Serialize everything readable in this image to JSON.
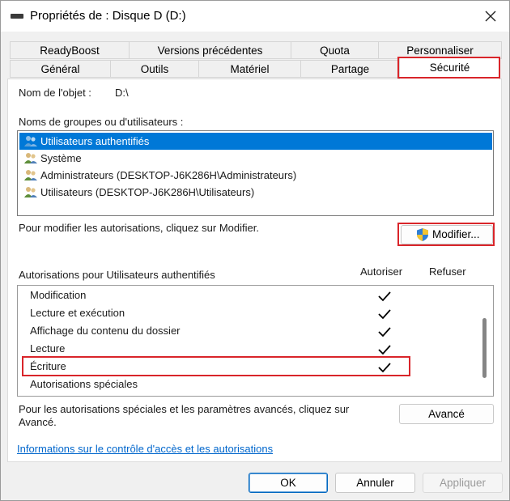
{
  "window": {
    "title": "Propriétés de : Disque D (D:)"
  },
  "tabs_row1": [
    "ReadyBoost",
    "Versions précédentes",
    "Quota",
    "Personnaliser"
  ],
  "tabs_row2": [
    "Général",
    "Outils",
    "Matériel",
    "Partage",
    "Sécurité"
  ],
  "object": {
    "label": "Nom de l'objet :",
    "value": "D:\\"
  },
  "groups": {
    "label": "Noms de groupes ou d'utilisateurs :",
    "items": [
      "Utilisateurs authentifiés",
      "Système",
      "Administrateurs (DESKTOP-J6K286H\\Administrateurs)",
      "Utilisateurs (DESKTOP-J6K286H\\Utilisateurs)"
    ]
  },
  "modify": {
    "hint": "Pour modifier les autorisations, cliquez sur Modifier.",
    "button": "Modifier..."
  },
  "permissions": {
    "title": "Autorisations pour Utilisateurs authentifiés",
    "allow_header": "Autoriser",
    "deny_header": "Refuser",
    "rows": [
      {
        "name": "Modification",
        "allow": true,
        "deny": false
      },
      {
        "name": "Lecture et exécution",
        "allow": true,
        "deny": false
      },
      {
        "name": "Affichage du contenu du dossier",
        "allow": true,
        "deny": false
      },
      {
        "name": "Lecture",
        "allow": true,
        "deny": false
      },
      {
        "name": "Écriture",
        "allow": true,
        "deny": false
      },
      {
        "name": "Autorisations spéciales",
        "allow": false,
        "deny": false
      }
    ]
  },
  "advanced": {
    "hint_line1": "Pour les autorisations spéciales et les paramètres avancés, cliquez sur",
    "hint_line2": "Avancé.",
    "button": "Avancé"
  },
  "link": "Informations sur le contrôle d'accès et les autorisations",
  "footer": {
    "ok": "OK",
    "cancel": "Annuler",
    "apply": "Appliquer"
  },
  "colors": {
    "selection": "#0078d7",
    "highlight": "#d9252a",
    "link": "#0066cc"
  }
}
